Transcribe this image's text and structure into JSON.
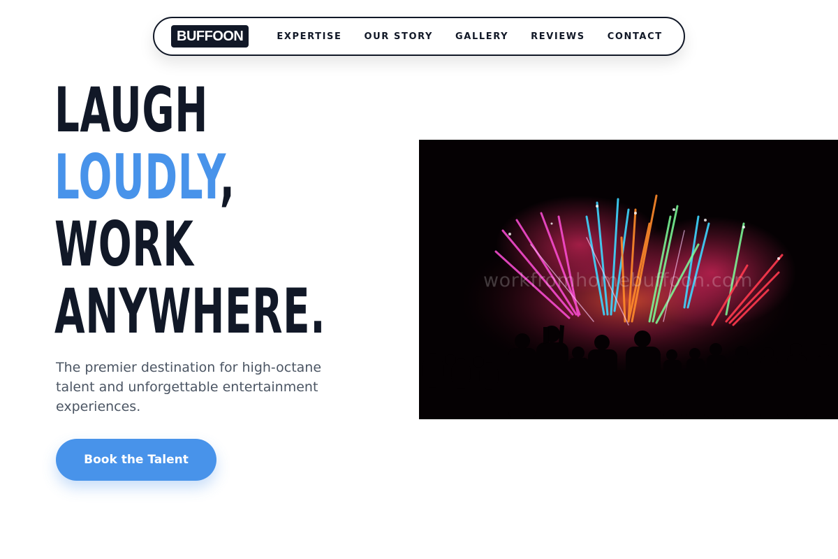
{
  "nav": {
    "logo": "BUFFOON",
    "links": [
      "EXPERTISE",
      "OUR STORY",
      "GALLERY",
      "REVIEWS",
      "CONTACT"
    ]
  },
  "hero": {
    "title_line1": "LAUGH",
    "title_accent": "LOUDLY",
    "title_comma": ",",
    "title_line3": "WORK",
    "title_line4": "ANYWHERE.",
    "subtitle": "The premier destination for high-octane talent and unforgettable entertainment experiences.",
    "cta_label": "Book the Talent"
  },
  "image": {
    "subject": "fireworks over crowd silhouettes",
    "watermark": "workfromhomebuffoon.com"
  },
  "colors": {
    "dark": "#111827",
    "accent": "#4893ea",
    "muted_text": "#4b5563"
  }
}
